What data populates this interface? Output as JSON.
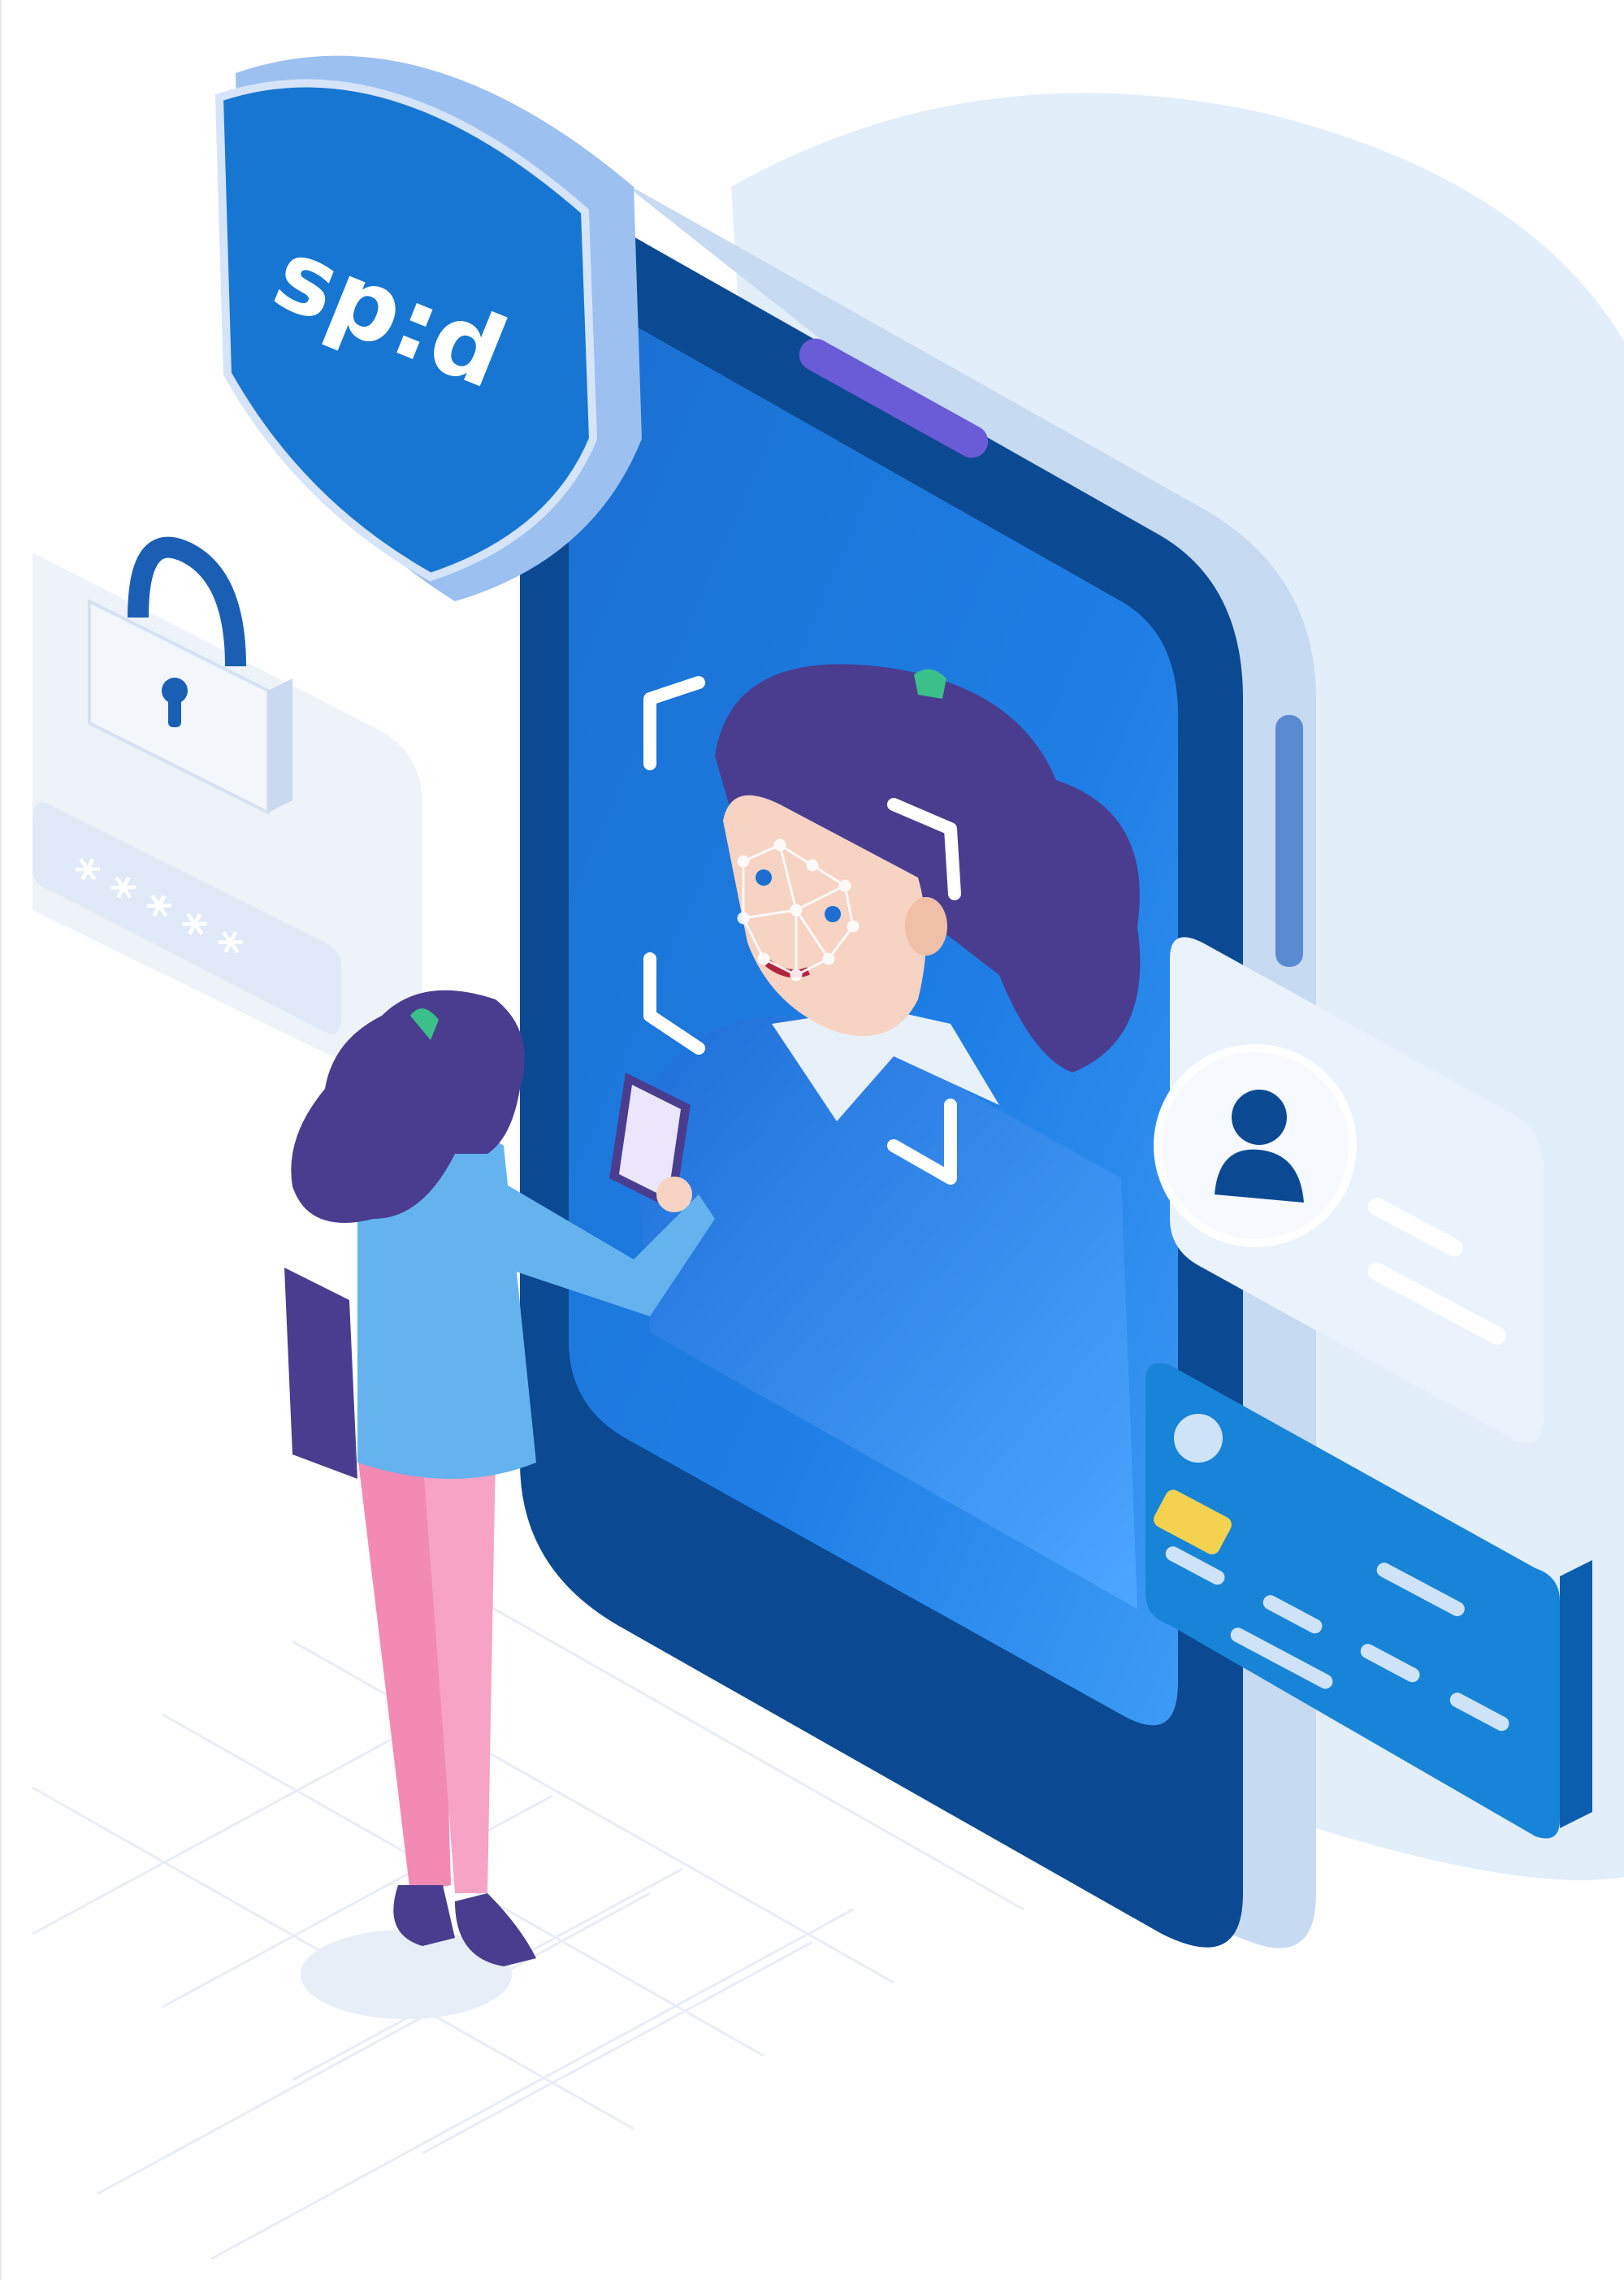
{
  "illustration": {
    "shield_logo_text": "sp:d",
    "password_dots": "*****",
    "colors": {
      "background_blob": "#e3eefb",
      "phone_frame": "#0b4a93",
      "phone_screen": "#1c7de0",
      "hair": "#4a3d8f",
      "skin": "#f6d3c2",
      "shirt": "#64b3ef",
      "pants": "#f38ab3",
      "card": "#1784d8",
      "card_chip": "#f2d24f",
      "shield": "#1776d1"
    },
    "icons": [
      "shield-logo-icon",
      "padlock-icon",
      "user-avatar-icon",
      "credit-card-icon",
      "face-scan-frame-icon"
    ]
  }
}
